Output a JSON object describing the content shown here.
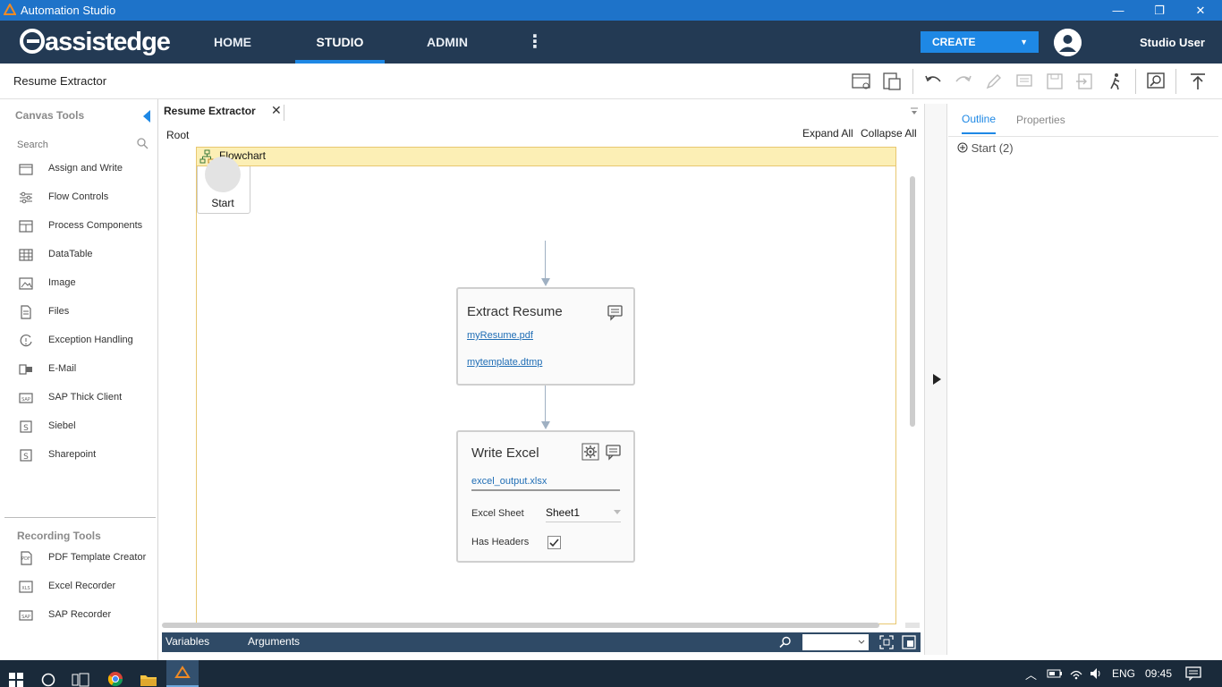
{
  "window": {
    "title": "Automation Studio",
    "minimize_symbol": "—",
    "restore_symbol": "❐",
    "close_symbol": "✕"
  },
  "navbar": {
    "logo_text": "assistedge",
    "tabs": [
      {
        "label": "HOME"
      },
      {
        "label": "STUDIO",
        "active": true
      },
      {
        "label": "ADMIN"
      }
    ],
    "more_symbol": "⋮",
    "create_label": "CREATE",
    "create_caret": "▼",
    "user_name": "Studio User"
  },
  "toolbar": {
    "document_title": "Resume Extractor"
  },
  "left_panel": {
    "canvas_tools_heading": "Canvas Tools",
    "search_placeholder": "Search",
    "tools": [
      {
        "label": "Assign and Write"
      },
      {
        "label": "Flow Controls"
      },
      {
        "label": "Process Components"
      },
      {
        "label": "DataTable"
      },
      {
        "label": "Image"
      },
      {
        "label": "Files"
      },
      {
        "label": "Exception Handling"
      },
      {
        "label": "E-Mail"
      },
      {
        "label": "SAP Thick Client"
      },
      {
        "label": "Siebel"
      },
      {
        "label": "Sharepoint"
      }
    ],
    "recording_tools_heading": "Recording Tools",
    "recording_tools": [
      {
        "label": "PDF Template Creator"
      },
      {
        "label": "Excel Recorder"
      },
      {
        "label": "SAP Recorder"
      }
    ]
  },
  "canvas": {
    "tab_label": "Resume Extractor",
    "tab_close": "✕",
    "breadcrumb": "Root",
    "expand_all": "Expand All",
    "collapse_all": "Collapse All",
    "flowchart_label": "Flowchart",
    "start_label": "Start",
    "extract_resume": {
      "title": "Extract Resume",
      "file_link": "myResume.pdf",
      "template_link": "mytemplate.dtmp"
    },
    "write_excel": {
      "title": "Write Excel",
      "file_link": "excel_output.xlsx",
      "sheet_label": "Excel Sheet",
      "sheet_value": "Sheet1",
      "headers_label": "Has Headers",
      "has_headers": true
    }
  },
  "bottom_bar": {
    "variables_label": "Variables",
    "arguments_label": "Arguments"
  },
  "right_panel": {
    "outline_tab": "Outline",
    "properties_tab": "Properties",
    "outline_item": "Start (2)"
  },
  "taskbar": {
    "language": "ENG",
    "time": "09:45"
  }
}
